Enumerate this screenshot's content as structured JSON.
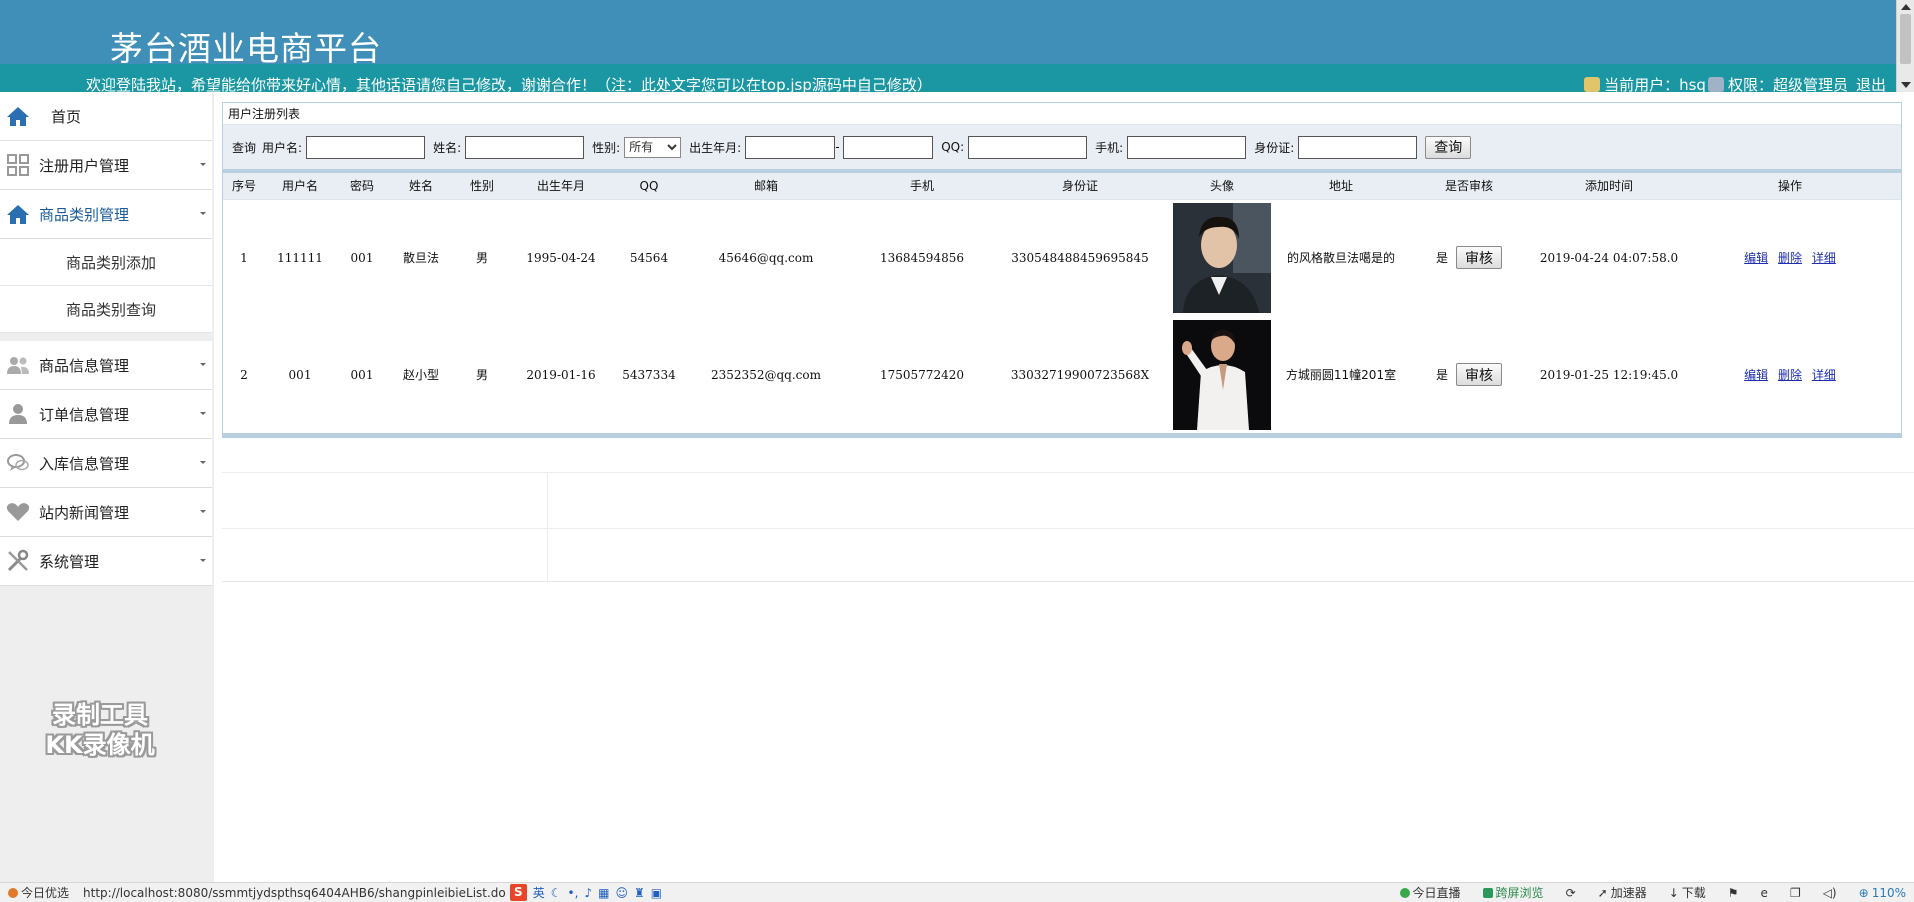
{
  "header": {
    "title": "茅台酒业电商平台",
    "welcome": "欢迎登陆我站，希望能给你带来好心情，其他话语请您自己修改，谢谢合作！（注：此处文字您可以在top.jsp源码中自己修改）",
    "current_user_label": "当前用户：hsq",
    "permission_label": "权限：超级管理员",
    "logout_label": "退出"
  },
  "sidebar": {
    "items": [
      {
        "label": "首页",
        "icon": "home-icon"
      },
      {
        "label": "注册用户管理",
        "icon": "grid-icon"
      },
      {
        "label": "商品类别管理",
        "icon": "home-icon"
      },
      {
        "label": "商品类别添加"
      },
      {
        "label": "商品类别查询"
      },
      {
        "label": "商品信息管理",
        "icon": "users-icon"
      },
      {
        "label": "订单信息管理",
        "icon": "user-icon"
      },
      {
        "label": "入库信息管理",
        "icon": "chat-icon"
      },
      {
        "label": "站内新闻管理",
        "icon": "heart-icon"
      },
      {
        "label": "系统管理",
        "icon": "tools-icon"
      }
    ],
    "watermark_line1": "录制工具",
    "watermark_line2": "KK录像机"
  },
  "panel": {
    "title": "用户注册列表"
  },
  "search": {
    "query_label": "查询",
    "username_label": "用户名:",
    "name_label": "姓名:",
    "gender_label": "性别:",
    "gender_selected": "所有",
    "birth_label": "出生年月:",
    "qq_label": "QQ:",
    "phone_label": "手机:",
    "idcard_label": "身份证:",
    "search_button": "查询"
  },
  "table": {
    "headers": [
      "序号",
      "用户名",
      "密码",
      "姓名",
      "性别",
      "出生年月",
      "QQ",
      "邮箱",
      "手机",
      "身份证",
      "头像",
      "地址",
      "是否审核",
      "添加时间",
      "操作"
    ],
    "rows": [
      {
        "no": "1",
        "username": "111111",
        "password": "001",
        "name": "散旦法",
        "gender": "男",
        "birth": "1995-04-24",
        "qq": "54564",
        "email": "45646@qq.com",
        "phone": "13684594856",
        "idcard": "330548488459695845",
        "address": "的风格散旦法噶是的",
        "reviewed": "是",
        "review_btn": "审核",
        "added": "2019-04-24 04:07:58.0",
        "op_edit": "编辑",
        "op_delete": "删除",
        "op_detail": "详细"
      },
      {
        "no": "2",
        "username": "001",
        "password": "001",
        "name": "赵小型",
        "gender": "男",
        "birth": "2019-01-16",
        "qq": "5437334",
        "email": "2352352@qq.com",
        "phone": "17505772420",
        "idcard": "33032719900723568X",
        "address": "方城丽圆11幢201室",
        "reviewed": "是",
        "review_btn": "审核",
        "added": "2019-01-25 12:19:45.0",
        "op_edit": "编辑",
        "op_delete": "删除",
        "op_detail": "详细"
      }
    ]
  },
  "statusbar": {
    "today_pick": "今日优选",
    "url": "http://localhost:8080/ssmmtjydspthsq6404AHB6/shangpinleibieList.do",
    "ime_mode": "英",
    "live": "今日直播",
    "split": "跨屏浏览",
    "accelerate": "加速器",
    "download": "下载",
    "zoom": "110%"
  },
  "colors": {
    "header_bg": "#3f8fb8",
    "band_bg": "#1a97a2",
    "link": "#1f2fb3",
    "active_menu": "#1a5a9a"
  }
}
